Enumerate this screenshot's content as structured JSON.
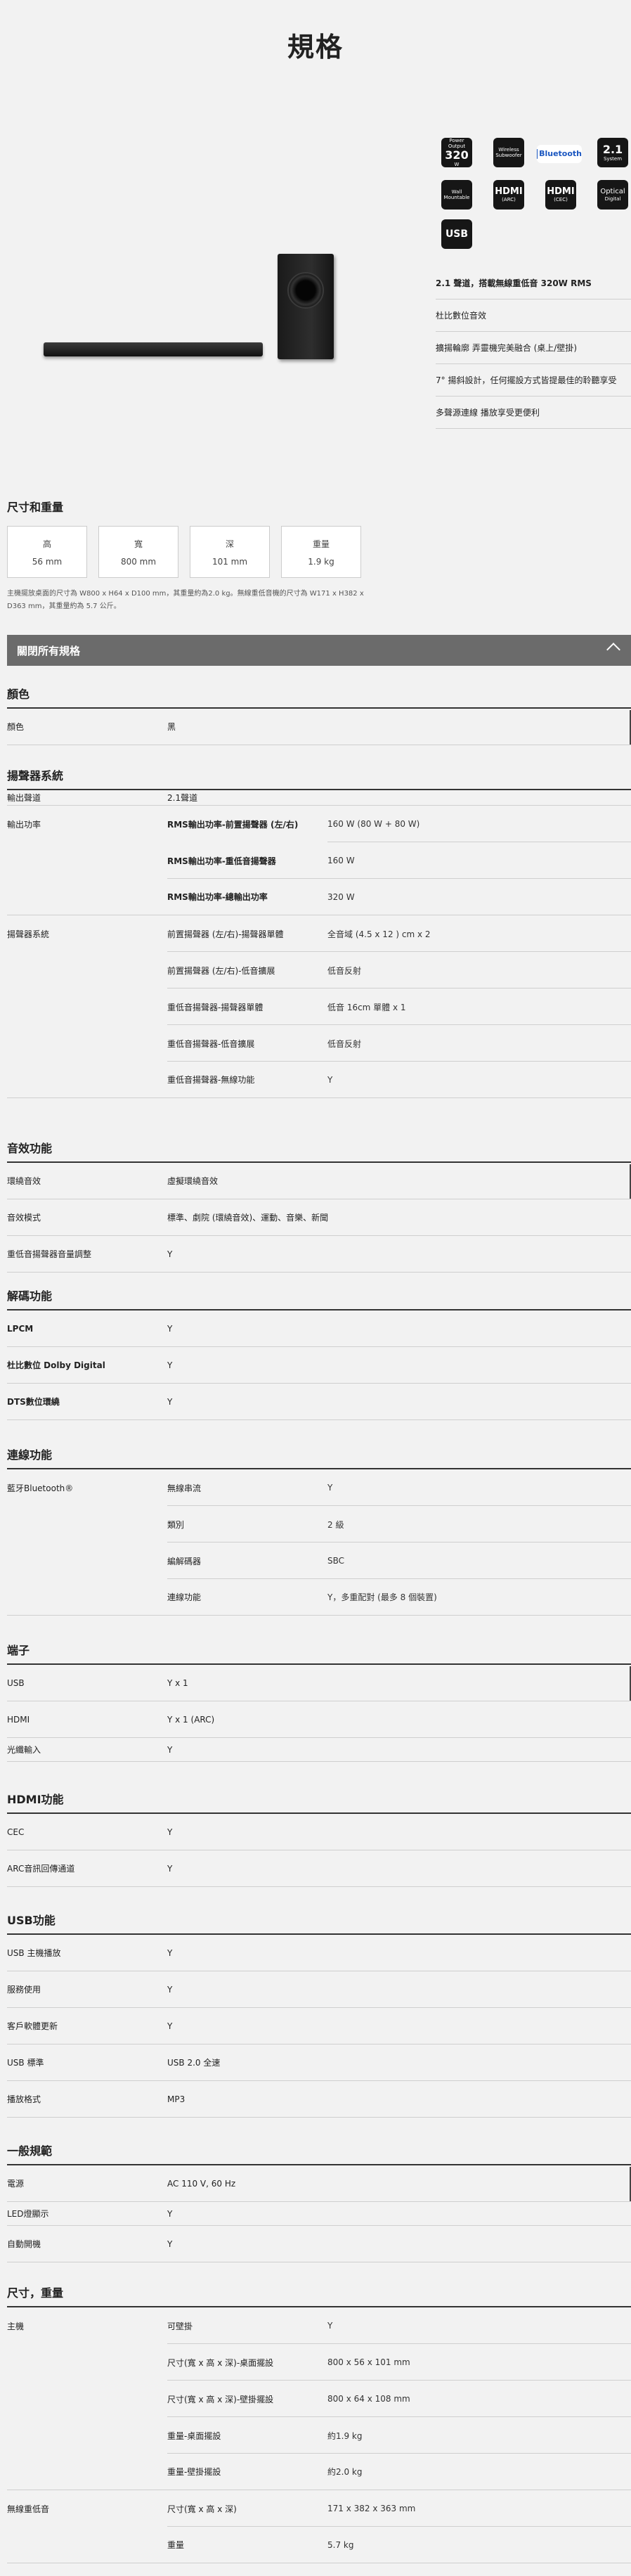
{
  "page": {
    "title": "規格"
  },
  "badges": [
    {
      "top": "Power Output",
      "big": "320",
      "bottom": "W"
    },
    {
      "top": "Wireless",
      "big": "",
      "bottom": "Subwoofer"
    },
    {
      "top": "",
      "big": "Bluetooth",
      "bottom": ""
    },
    {
      "top": "",
      "big": "2.1",
      "bottom": "System"
    },
    {
      "top": "Wall",
      "big": "",
      "bottom": "Mountable"
    },
    {
      "top": "",
      "big": "HDMI",
      "bottom": "(ARC)"
    },
    {
      "top": "",
      "big": "HDMI",
      "bottom": "(CEC)"
    },
    {
      "top": "",
      "big": "Optical",
      "bottom": "Digital"
    },
    {
      "top": "",
      "big": "USB",
      "bottom": ""
    }
  ],
  "features": [
    "2.1 聲道，搭載無線重低音 320W RMS",
    "杜比數位音效",
    "擴揚輪廓 弄靈機完美融合 (桌上/壁掛)",
    "7° 揚斜設計，任何擺設方式皆提最佳的聆聽享受",
    "多聲源連線 播放享受更便利"
  ],
  "dimensions": {
    "heading": "尺寸和重量",
    "cards": [
      {
        "label": "高",
        "value": "56 mm"
      },
      {
        "label": "寬",
        "value": "800 mm"
      },
      {
        "label": "深",
        "value": "101 mm"
      },
      {
        "label": "重量",
        "value": "1.9 kg"
      }
    ],
    "note": "主機擺放桌面的尺寸為 W800 x H64 x D100 mm，其重量約為2.0 kg。無線重低音機的尺寸為 W171 x H382 x D363 mm，其重量約為 5.7 公斤。"
  },
  "collapse": {
    "label": "關閉所有規格"
  },
  "sections": {
    "color": {
      "title": "顏色",
      "rows": [
        [
          "顏色",
          "黑",
          ""
        ]
      ]
    },
    "speaker": {
      "title": "揚聲器系統",
      "rows": [
        [
          "輸出聲道",
          "2.1聲道",
          ""
        ],
        [
          "輸出功率",
          "RMS輸出功率-前置揚聲器 (左/右)",
          "160 W (80 W + 80 W)"
        ],
        [
          "",
          "RMS輸出功率-重低音揚聲器",
          "160 W"
        ],
        [
          "",
          "RMS輸出功率-總輸出功率",
          "320 W"
        ],
        [
          "揚聲器系統",
          "前置揚聲器 (左/右)-揚聲器單體",
          "全音域 (4.5 x 12 ) cm x 2"
        ],
        [
          "",
          "前置揚聲器 (左/右)-低音擴展",
          "低音反射"
        ],
        [
          "",
          "重低音揚聲器-揚聲器單體",
          "低音 16cm 單體 x 1"
        ],
        [
          "",
          "重低音揚聲器-低音擴展",
          "低音反射"
        ],
        [
          "",
          "重低音揚聲器-無線功能",
          "Y"
        ]
      ]
    },
    "sound": {
      "title": "音效功能",
      "rows": [
        [
          "環繞音效",
          "虛擬環繞音效",
          ""
        ],
        [
          "音效模式",
          "標準、劇院 (環繞音效)、運動、音樂、新聞",
          ""
        ],
        [
          "重低音揚聲器音量調整",
          "Y",
          ""
        ]
      ]
    },
    "decode": {
      "title": "解碼功能",
      "rows": [
        [
          "LPCM",
          "Y",
          ""
        ],
        [
          "杜比數位 Dolby Digital",
          "Y",
          ""
        ],
        [
          "DTS數位環繞",
          "Y",
          ""
        ]
      ]
    },
    "connect": {
      "title": "連線功能",
      "rows": [
        [
          "藍牙Bluetooth®",
          "無線串流",
          "Y"
        ],
        [
          "",
          "類別",
          "2 級"
        ],
        [
          "",
          "編解碼器",
          "SBC"
        ],
        [
          "",
          "連線功能",
          "Y，多重配對 (最多 8 個裝置)"
        ]
      ]
    },
    "ports": {
      "title": "端子",
      "rows": [
        [
          "USB",
          "Y x 1",
          ""
        ],
        [
          "HDMI",
          "Y x 1 (ARC)",
          ""
        ],
        [
          "光纖輸入",
          "Y",
          ""
        ]
      ]
    },
    "hdmi": {
      "title": "HDMI功能",
      "rows": [
        [
          "CEC",
          "Y",
          ""
        ],
        [
          "ARC音訊回傳通道",
          "Y",
          ""
        ]
      ]
    },
    "usb": {
      "title": "USB功能",
      "rows": [
        [
          "USB 主機播放",
          "Y",
          ""
        ],
        [
          "服務使用",
          "Y",
          ""
        ],
        [
          "客戶軟體更新",
          "Y",
          ""
        ],
        [
          "USB 標準",
          "USB 2.0 全速",
          ""
        ],
        [
          "播放格式",
          "MP3",
          ""
        ]
      ]
    },
    "general": {
      "title": "一般規範",
      "rows": [
        [
          "電源",
          "AC 110 V, 60 Hz",
          ""
        ],
        [
          "LED燈顯示",
          "Y",
          ""
        ],
        [
          "自動開機",
          "Y",
          ""
        ]
      ]
    },
    "size": {
      "title": "尺寸，重量",
      "rows": [
        [
          "主機",
          "可壁掛",
          "Y"
        ],
        [
          "",
          "尺寸(寬 x 高 x 深)-桌面擺設",
          "800 x 56 x 101 mm"
        ],
        [
          "",
          "尺寸(寬 x 高 x 深)-壁掛擺設",
          "800 x 64 x 108 mm"
        ],
        [
          "",
          "重量-桌面擺設",
          "約1.9 kg"
        ],
        [
          "",
          "重量-壁掛擺設",
          "約2.0 kg"
        ],
        [
          "無線重低音",
          "尺寸(寬 x 高 x 深)",
          "171 x 382 x 363 mm"
        ],
        [
          "",
          "重量",
          "5.7 kg"
        ]
      ]
    }
  }
}
